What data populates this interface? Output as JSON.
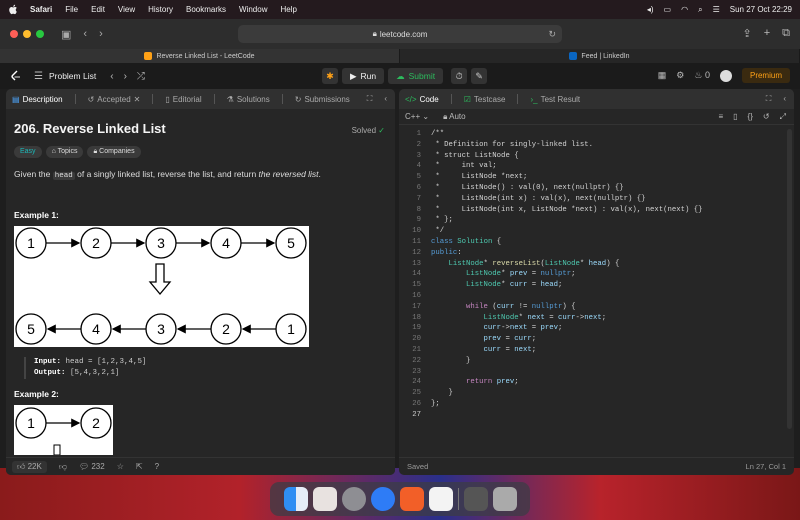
{
  "menubar": {
    "app": "Safari",
    "items": [
      "File",
      "Edit",
      "View",
      "History",
      "Bookmarks",
      "Window",
      "Help"
    ],
    "datetime": "Sun 27 Oct  22:29"
  },
  "browser": {
    "url": "leetcode.com",
    "tabs": [
      {
        "label": "Reverse Linked List - LeetCode",
        "active": true
      },
      {
        "label": "Feed | LinkedIn",
        "active": false
      }
    ]
  },
  "header": {
    "problem_list": "Problem List",
    "run": "Run",
    "submit": "Submit",
    "streak": "0",
    "premium": "Premium"
  },
  "left_tabs": {
    "description": "Description",
    "accepted": "Accepted",
    "editorial": "Editorial",
    "solutions": "Solutions",
    "submissions": "Submissions"
  },
  "problem": {
    "title": "206. Reverse Linked List",
    "status": "Solved",
    "difficulty": "Easy",
    "topics": "Topics",
    "companies": "Companies",
    "desc_pre": "Given the ",
    "desc_code": "head",
    "desc_mid": " of a singly linked list, reverse the list, and return ",
    "desc_em": "the reversed list",
    "desc_post": ".",
    "example1_title": "Example 1:",
    "example1_input_label": "Input:",
    "example1_input": "head = [1,2,3,4,5]",
    "example1_output_label": "Output:",
    "example1_output": "[5,4,3,2,1]",
    "example2_title": "Example 2:",
    "top_nodes": [
      "1",
      "2",
      "3",
      "4",
      "5"
    ],
    "bottom_nodes": [
      "5",
      "4",
      "3",
      "2",
      "1"
    ],
    "ex2_nodes": [
      "1",
      "2"
    ]
  },
  "footer": {
    "likes": "22K",
    "comments": "232"
  },
  "editor": {
    "tab_code": "Code",
    "tab_testcase": "Testcase",
    "tab_result": "Test Result",
    "language": "C++",
    "mode": "Auto",
    "status": "Saved",
    "cursor": "Ln 27, Col 1"
  },
  "colors": {
    "accent": "#ffa116",
    "success": "#2cbb5d",
    "easy": "#1cb8b8"
  }
}
